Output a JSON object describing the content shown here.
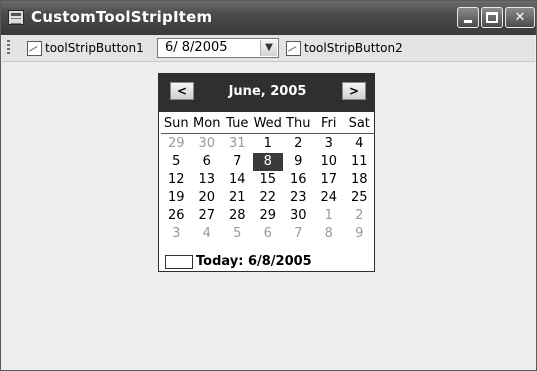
{
  "window": {
    "title": "CustomToolStripItem"
  },
  "toolstrip": {
    "button1_label": "toolStripButton1",
    "button2_label": "toolStripButton2",
    "date_value": "6/ 8/2005"
  },
  "calendar": {
    "month_label": "June, 2005",
    "prev_label": "<",
    "next_label": ">",
    "days_of_week": [
      "Sun",
      "Mon",
      "Tue",
      "Wed",
      "Thu",
      "Fri",
      "Sat"
    ],
    "weeks": [
      [
        "29",
        "30",
        "31",
        "1",
        "2",
        "3",
        "4"
      ],
      [
        "5",
        "6",
        "7",
        "8",
        "9",
        "10",
        "11"
      ],
      [
        "12",
        "13",
        "14",
        "15",
        "16",
        "17",
        "18"
      ],
      [
        "19",
        "20",
        "21",
        "22",
        "23",
        "24",
        "25"
      ],
      [
        "26",
        "27",
        "28",
        "29",
        "30",
        "1",
        "2"
      ],
      [
        "3",
        "4",
        "5",
        "6",
        "7",
        "8",
        "9"
      ]
    ],
    "selected_day": "8",
    "today_label": "Today: 6/8/2005"
  },
  "colors": {
    "titlebar": "#3a3a3a",
    "selected": "#3a3a3a",
    "dimmed": "#9a9a9a"
  }
}
